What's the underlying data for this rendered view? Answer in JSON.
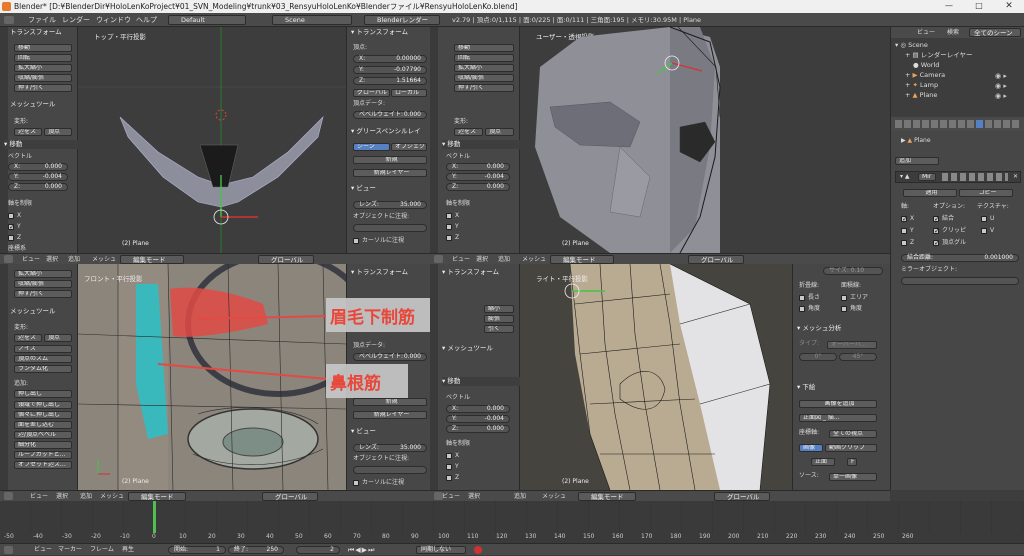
{
  "title_bar": "Blender* [D:¥BlenderDir¥HoloLenKoProject¥01_SVN_Modeling¥trunk¥03_RensyuHoloLenKo¥Blenderファイル¥RensyuHoloLenKo.blend]",
  "menu": [
    "ファイル",
    "レンダー",
    "ウィンドウ",
    "ヘルプ"
  ],
  "layout": "Default",
  "scene": "Scene",
  "engine": "Blenderレンダー",
  "stats": "v2.79 | 頂点:0/1,115 | 面:0/225 | 面:0/111 | 三角面:195 | メモリ:30.95M | Plane",
  "outliner_header": {
    "view": "ビュー",
    "search": "検索",
    "filter": "全てのシーン"
  },
  "outliner": [
    "Scene",
    "レンダーレイヤー",
    "World",
    "Camera",
    "Lamp",
    "Plane"
  ],
  "tool_tl": {
    "section": "トランスフォーム",
    "buttons": [
      "移動",
      "回転",
      "拡大縮小",
      "収縮/膨張",
      "押す/引く"
    ],
    "mesh_tools": "メッシュツール",
    "deform": "変形:",
    "slide_edge": "辺をス",
    "vertex": "頂点",
    "move": "移動",
    "vector": "ベクトル",
    "x": "0.000",
    "y": "-0.004",
    "z": "0.000",
    "constraint": "軸を制限",
    "ax": "X",
    "ay": "Y",
    "az": "Z",
    "orientation": "座標系"
  },
  "vp_tl": {
    "title": "トップ・平行投影",
    "obj": "(2) Plane"
  },
  "vp_tr": {
    "title": "ユーザー・透視投影",
    "obj": "(2) Plane"
  },
  "vp_bl": {
    "title": "フロント・平行投影",
    "obj": "(2) Plane"
  },
  "vp_br": {
    "title": "ライト・平行投影",
    "obj": "(2) Plane"
  },
  "vphdr": {
    "view": "ビュー",
    "select": "選択",
    "add": "追加",
    "mesh": "メッシュ",
    "mode": "編集モード",
    "global": "グローバル"
  },
  "annot1": "眉毛下制筋",
  "annot2": "鼻根筋",
  "nprop_tl": {
    "section": "トランスフォーム",
    "vertex": "頂点:",
    "x": "0.00000",
    "y": "-0.07790",
    "z": "1.51664",
    "global": "グローバル",
    "local": "ローカル",
    "vdata": "頂点データ:",
    "bevel": "ベベルウェイト:",
    "bevel_val": "0.000",
    "gp": "グリースペンシルレイ",
    "scene_btn": "シーン",
    "object_btn": "オブジェクト",
    "new": "新規",
    "newlayer": "新規レイヤー",
    "view": "ビュー",
    "lens": "レンズ:",
    "lens_val": "35.000",
    "lockobj": "オブジェクトに注視:",
    "lockcursor": "カーソルに注視"
  },
  "tool_tr": {
    "buttons": [
      "移動",
      "回転",
      "拡大縮小",
      "収縮/膨張",
      "押す/引く"
    ],
    "deform": "変形:",
    "slide_edge": "辺をス",
    "vertex": "頂点",
    "move": "移動",
    "vector": "ベクトル",
    "x": "0.000",
    "y": "-0.004",
    "z": "0.000",
    "constraint": "軸を制限",
    "ax": "X",
    "ay": "Y",
    "az": "Z"
  },
  "tool_bl": {
    "buttons": [
      "拡大縮小",
      "収縮/膨張",
      "押す/引く"
    ],
    "mesh_tools": "メッシュツール",
    "deform": "変形:",
    "slide_edge": "辺をス",
    "vertex": "頂点",
    "noise": "ノイズ",
    "smooth": "頂点のスム",
    "random": "ランダム化",
    "add": "追加:",
    "extrude": "押し出し",
    "extrude_indiv": "領域で押し出し",
    "extrude_indiv2": "個々に押し出し",
    "inset": "面を差し込む",
    "bevel": "辺/頂点ベベル",
    "subdiv": "細分化",
    "loopcut": "ループカットと...",
    "offset": "オフセット辺ス..."
  },
  "nprop_bl": {
    "section": "トランスフォーム",
    "vdata": "頂点データ:",
    "bevel": "ベベルウェイト:",
    "bevel_val": "0.000",
    "new": "新規",
    "newlayer": "新規レイヤー",
    "view": "ビュー",
    "lens": "レンズ:",
    "lens_val": "35.000",
    "lockobj": "オブジェクトに注視:",
    "lockcursor": "カーソルに注視"
  },
  "tool_br": {
    "section": "トランスフォーム",
    "buttons": [
      "縮小",
      "膨張",
      "引く"
    ],
    "mesh_tools": "メッシュツール",
    "move": "移動",
    "vector": "ベクトル",
    "x": "0.000",
    "y": "-0.004",
    "z": "0.000",
    "constraint": "軸を制限",
    "ax": "X",
    "ay": "Y",
    "az": "Z"
  },
  "props": {
    "object": "Plane",
    "add": "追加",
    "mir": "Mir",
    "apply": "適用",
    "copy": "コピー",
    "axis": "軸:",
    "options": "オプション:",
    "texture": "テクスチャ:",
    "x": "X",
    "y": "Y",
    "z": "Z",
    "merge": "結合",
    "clip": "クリッピ",
    "vgroup": "頂点グル",
    "u": "U",
    "v": "V",
    "merge_dist": "結合距離:",
    "merge_val": "0.001000",
    "mirror_obj": "ミラーオブジェクト:"
  },
  "props_lower": {
    "size": "サイズ: 0.10",
    "fold": "折畳線:",
    "face_dir": "面積線:",
    "length": "長さ",
    "area": "エリア",
    "angle": "角度",
    "angle2": "角度",
    "mesh_anal": "メッシュ分析",
    "type": "タイプ:",
    "overhang": "オーバーハ...",
    "deg0": "0°",
    "deg45": "45°",
    "under": "下絵",
    "add_image": "画像を追加",
    "front": "正面図 _ 描...",
    "axis": "座標軸:",
    "all_views": "全ての視点",
    "image": "画像",
    "movieclip": "動画クリップ",
    "front2": "正面",
    "f": "F",
    "source": "ソース:",
    "single": "単一画像"
  },
  "timeline": {
    "ticks": [
      "-50",
      "-40",
      "-30",
      "-20",
      "-10",
      "0",
      "10",
      "20",
      "30",
      "40",
      "50",
      "60",
      "70",
      "80",
      "90",
      "100",
      "110",
      "120",
      "130",
      "140",
      "150",
      "160",
      "170",
      "180",
      "190",
      "200",
      "210",
      "220",
      "230",
      "240",
      "250",
      "260"
    ],
    "view": "ビュー",
    "marker": "マーカー",
    "frame": "フレーム",
    "playback": "再生",
    "start": "開始:",
    "start_val": "1",
    "end": "終了:",
    "end_val": "250",
    "current": "2",
    "sync": "同期しない"
  }
}
